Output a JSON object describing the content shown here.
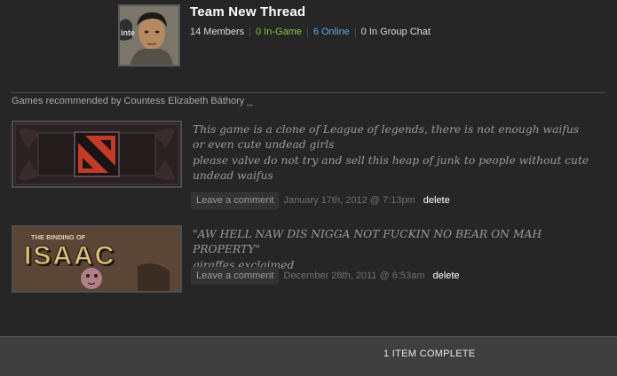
{
  "group": {
    "name": "Team New Thread",
    "members": "14 Members",
    "in_game": "0 In-Game",
    "online": "6 Online",
    "group_chat": "0 In Group Chat",
    "avatar_icon": "user-avatar-icon"
  },
  "section_title": "Games recommended by Countess Elizabeth Báthory _",
  "recommendations": [
    {
      "game_logo_icon": "dota2-logo-icon",
      "review_line_1": "This game is a clone of League of legends, there is not enough waifus or even cute undead girls",
      "review_line_2": "please valve do not try and sell this heap of junk to people without cute undead waifus",
      "comment_label": "Leave a comment",
      "date": "January 17th, 2012 @ 7:13pm",
      "delete_label": "delete"
    },
    {
      "game_logo_icon": "binding-of-isaac-logo-icon",
      "logo_caption": "THE BINDING OF",
      "logo_title": "ISAAC",
      "review_line_1": "\"AW HELL NAW DIS NIGGA NOT FUCKIN NO BEAR ON MAH PROPERTY\"",
      "review_line_2": "giraffes exclaimed",
      "comment_label": "Leave a comment",
      "date": "December 28th, 2011 @ 6:53am",
      "delete_label": "delete"
    }
  ],
  "status_bar": {
    "text": "1 ITEM COMPLETE"
  },
  "colors": {
    "in_game": "#8bc53f",
    "online": "#62a7e3",
    "background": "#262626",
    "status_bar": "#3f3f3f"
  }
}
